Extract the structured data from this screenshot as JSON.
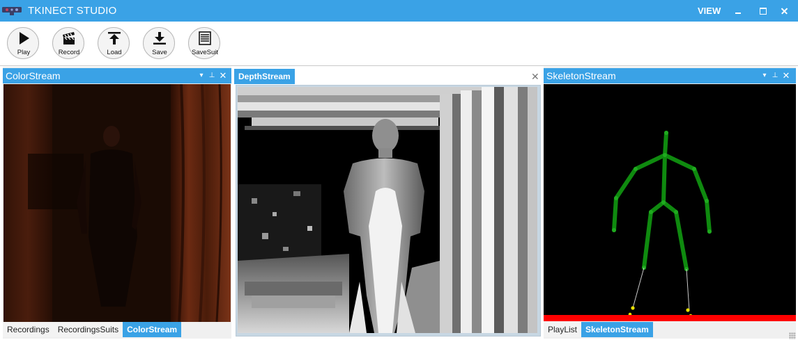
{
  "app": {
    "title": "TKINECT STUDIO",
    "menu_view": "VIEW",
    "accent_color": "#3aa2e6",
    "icons": {
      "logo": "kinect-sensor-icon",
      "minimize": "minimize-icon",
      "maximize": "maximize-icon",
      "close": "close-icon"
    }
  },
  "toolbar": {
    "buttons": [
      {
        "label": "Play",
        "icon": "play-icon"
      },
      {
        "label": "Record",
        "icon": "clapperboard-icon"
      },
      {
        "label": "Load",
        "icon": "upload-icon"
      },
      {
        "label": "Save",
        "icon": "download-icon"
      },
      {
        "label": "SaveSuit",
        "icon": "list-icon"
      }
    ]
  },
  "panels": {
    "color": {
      "title": "ColorStream",
      "header_icons": [
        "dropdown-icon",
        "pin-icon",
        "close-icon"
      ],
      "tabs": [
        "Recordings",
        "RecordingsSuits",
        "ColorStream"
      ],
      "active_tab": "ColorStream"
    },
    "depth": {
      "title": "DepthStream",
      "close_icon": "close-icon"
    },
    "skeleton": {
      "title": "SkeletonStream",
      "header_icons": [
        "dropdown-icon",
        "pin-icon",
        "close-icon"
      ],
      "tabs": [
        "PlayList",
        "SkeletonStream"
      ],
      "active_tab": "SkeletonStream",
      "colors": {
        "bone": "#0f8a0f",
        "joint": "#1faa1f",
        "foot_joint": "#e8e000",
        "floor": "#ff0000",
        "background": "#000000"
      }
    }
  }
}
